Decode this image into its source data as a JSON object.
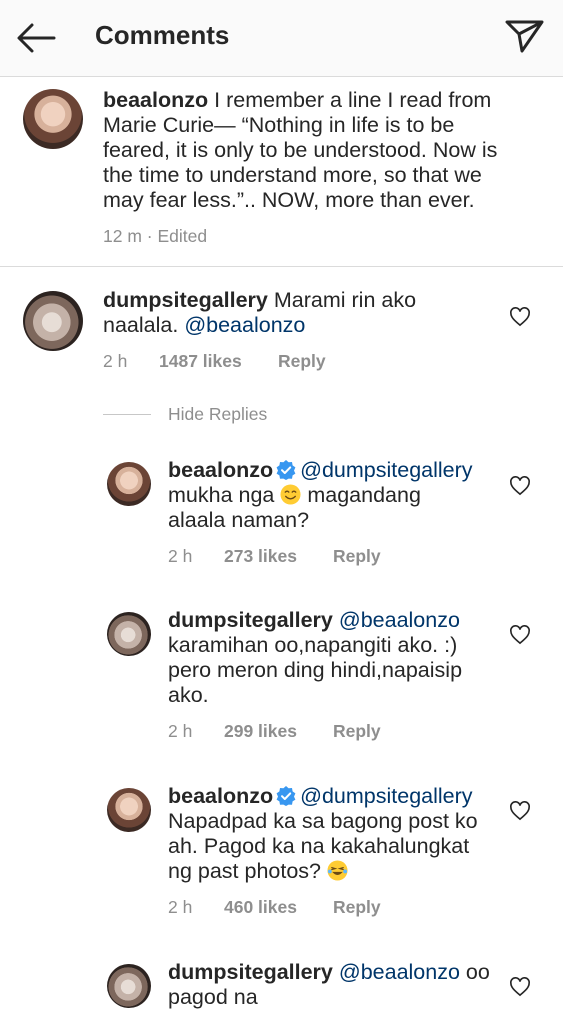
{
  "header": {
    "title": "Comments",
    "back_icon": "arrow-left-icon",
    "send_icon": "paper-plane-icon"
  },
  "caption": {
    "username": "beaalonzo",
    "lines": [
      "I remember a line I read from",
      "Marie Curie— “Nothing in life is to be",
      "feared, it is only to be understood. Now is",
      "the time to understand more, so that we",
      "may fear less.”.. NOW, more than ever."
    ],
    "time": "12 m",
    "separator": "·",
    "edited": "Edited"
  },
  "comments": [
    {
      "username": "dumpsitegallery",
      "line1": "Marami rin ako",
      "line2": "naalala.",
      "mention": "@beaalonzo",
      "time": "2 h",
      "likes": "1487 likes",
      "reply": "Reply"
    }
  ],
  "hide_replies": "Hide Replies",
  "replies": [
    {
      "username": "beaalonzo",
      "verified": true,
      "mention": "@dumpsitegallery",
      "line1a": "mukha nga",
      "line1b": "magandang",
      "line2": "alaala naman?",
      "time": "2 h",
      "likes": "273 likes",
      "reply": "Reply"
    },
    {
      "username": "dumpsitegallery",
      "mention": "@beaalonzo",
      "line1": "karamihan oo,napangiti ako. :)",
      "line2": "pero meron ding hindi,napaisip",
      "line3": "ako.",
      "time": "2 h",
      "likes": "299 likes",
      "reply": "Reply"
    },
    {
      "username": "beaalonzo",
      "verified": true,
      "mention": "@dumpsitegallery",
      "line1": "Napadpad ka sa bagong post ko",
      "line2": "ah. Pagod ka na kakahalungkat",
      "line3": "ng past photos?",
      "time": "2 h",
      "likes": "460 likes",
      "reply": "Reply"
    },
    {
      "username": "dumpsitegallery",
      "mention": "@beaalonzo",
      "line1b": "oo",
      "line2": "pagod na"
    }
  ],
  "colors": {
    "mention": "#003569",
    "meta": "#8e8e8e",
    "verified": "#3897f0",
    "divider": "#dbdbdb"
  }
}
